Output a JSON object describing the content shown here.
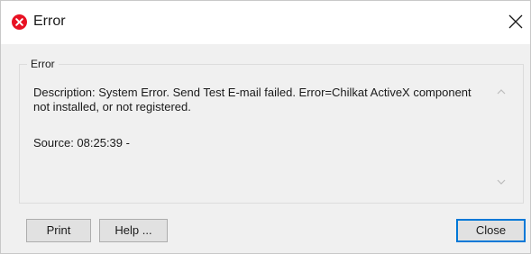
{
  "window": {
    "title": "Error",
    "title_icon": "error-x-icon",
    "close_icon": "close-icon"
  },
  "group": {
    "label": "Error"
  },
  "message": {
    "description": "Description: System Error. Send Test E-mail failed. Error=Chilkat ActiveX component not installed, or not registered.",
    "source": "Source:  08:25:39 -"
  },
  "scrollbar": {
    "up_icon": "chevron-up-icon",
    "down_icon": "chevron-down-icon"
  },
  "buttons": {
    "print_label": "Print",
    "help_label": "Help ...",
    "close_label": "Close"
  },
  "colors": {
    "error_red": "#e81123",
    "focus_blue": "#0078d7",
    "dialog_bg": "#f0f0f0"
  }
}
